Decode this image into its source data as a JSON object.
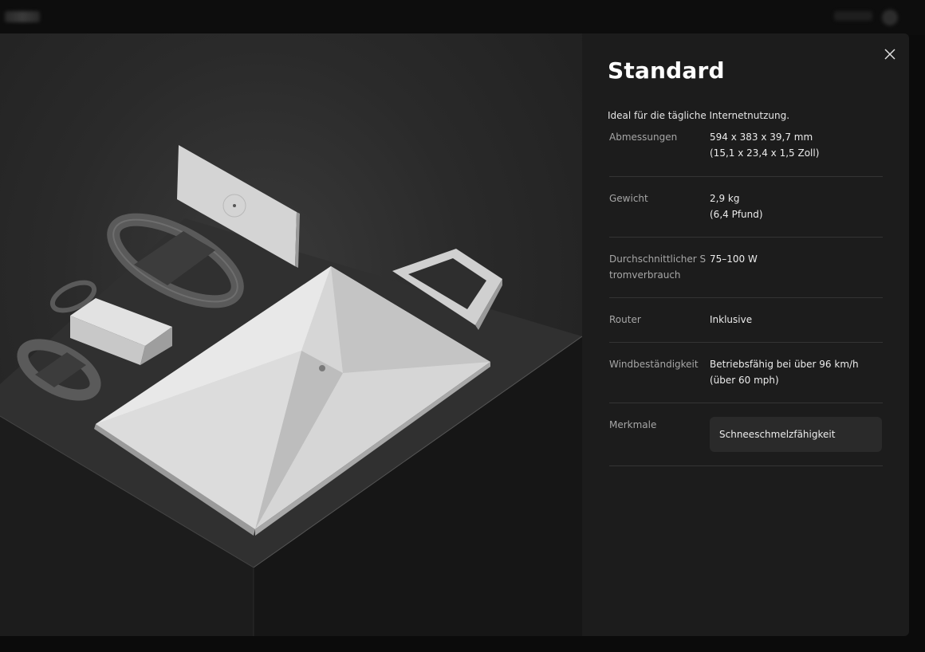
{
  "modal": {
    "title": "Standard",
    "subtitle": "Ideal für die tägliche Internetnutzung.",
    "close_icon": "close-icon",
    "specs": [
      {
        "label": "Abmessungen",
        "value_line1": "594 x 383 x 39,7 mm",
        "value_line2": "(15,1 x 23,4 x 1,5 Zoll)"
      },
      {
        "label": "Gewicht",
        "value_line1": "2,9 kg",
        "value_line2": "(6,4 Pfund)"
      },
      {
        "label": "Durchschnittlicher Stromverbrauch",
        "value_line1": "75–100 W"
      },
      {
        "label": "Router",
        "value_line1": "Inklusive"
      },
      {
        "label": "Windbeständigkeit",
        "value_line1": "Betriebsfähig bei über 96 km/h",
        "value_line2": "(über 60 mph)"
      },
      {
        "label": "Merkmale",
        "chip": "Schneeschmelzfähigkeit"
      }
    ]
  },
  "colors": {
    "modal_info_bg": "#1c1c1c",
    "page_bg": "#0b0b0b",
    "divider": "#343434",
    "chip_bg": "#2a2a2a"
  }
}
